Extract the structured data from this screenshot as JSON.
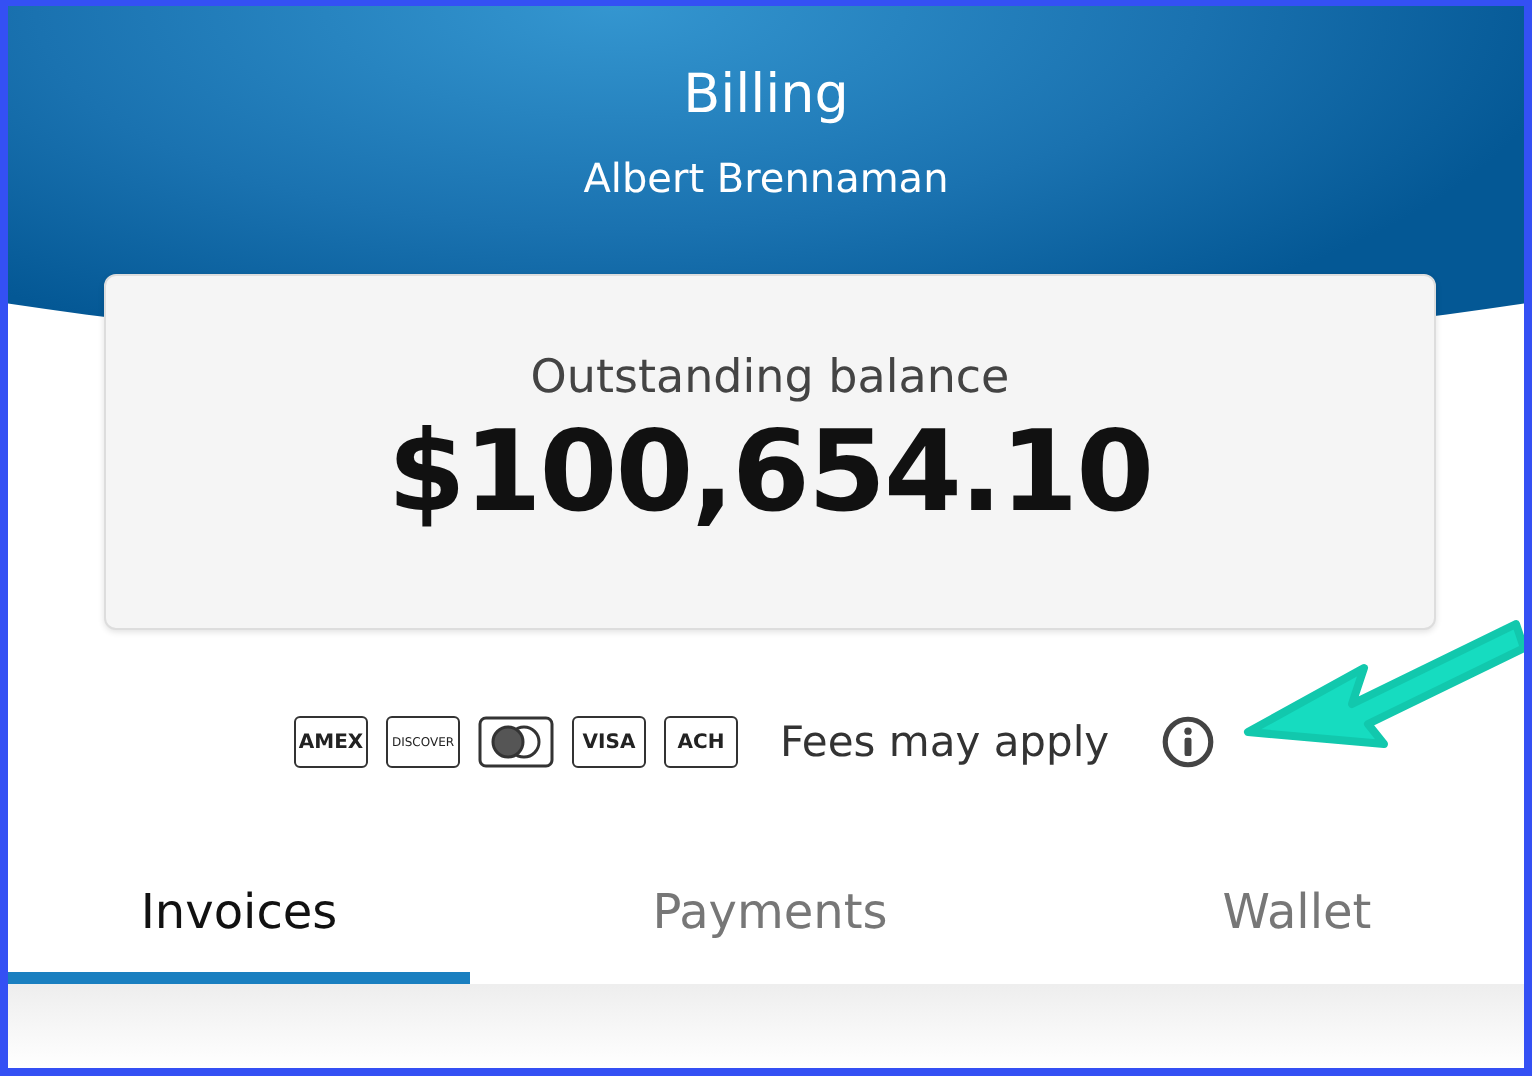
{
  "header": {
    "title": "Billing",
    "subtitle": "Albert Brennaman"
  },
  "balance": {
    "label": "Outstanding balance",
    "amount": "$100,654.10"
  },
  "payment_methods": [
    {
      "kind": "text",
      "label": "AMEX"
    },
    {
      "kind": "text",
      "label": "DISCOVER"
    },
    {
      "kind": "mastercard"
    },
    {
      "kind": "text",
      "label": "VISA"
    },
    {
      "kind": "text",
      "label": "ACH"
    }
  ],
  "fees_note": "Fees may apply",
  "tabs": [
    {
      "label": "Invoices",
      "selected": true
    },
    {
      "label": "Payments",
      "selected": false
    },
    {
      "label": "Wallet",
      "selected": false
    }
  ]
}
